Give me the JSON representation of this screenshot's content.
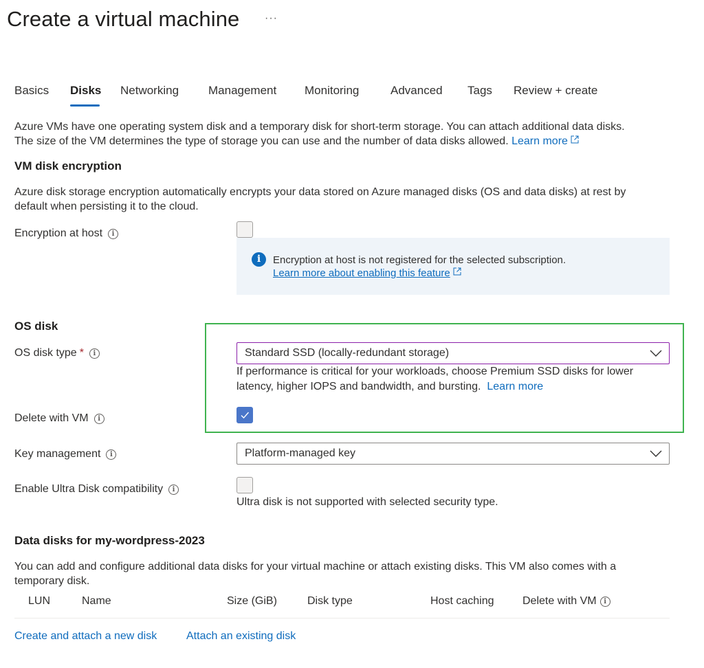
{
  "page": {
    "title": "Create a virtual machine",
    "more": "···"
  },
  "tabs": [
    {
      "label": "Basics",
      "active": false
    },
    {
      "label": "Disks",
      "active": true
    },
    {
      "label": "Networking",
      "active": false
    },
    {
      "label": "Management",
      "active": false
    },
    {
      "label": "Monitoring",
      "active": false
    },
    {
      "label": "Advanced",
      "active": false
    },
    {
      "label": "Tags",
      "active": false
    },
    {
      "label": "Review + create",
      "active": false
    }
  ],
  "intro": {
    "line1": "Azure VMs have one operating system disk and a temporary disk for short-term storage. You can attach additional data disks.",
    "line2": "The size of the VM determines the type of storage you can use and the number of data disks allowed.",
    "learn_more": "Learn more"
  },
  "encryption": {
    "heading": "VM disk encryption",
    "desc_line1": "Azure disk storage encryption automatically encrypts your data stored on Azure managed disks (OS and data disks) at rest by",
    "desc_line2": "default when persisting it to the cloud.",
    "host_label": "Encryption at host",
    "host_checked": false,
    "notice": "Encryption at host is not registered for the selected subscription.",
    "notice_link": "Learn more about enabling this feature"
  },
  "os_disk": {
    "heading": "OS disk",
    "type_label": "OS disk type",
    "type_required": "*",
    "type_value": "Standard SSD (locally-redundant storage)",
    "hint_line1": "If performance is critical for your workloads, choose Premium SSD disks for lower",
    "hint_line2": "latency, higher IOPS and bandwidth, and bursting.",
    "hint_link": "Learn more",
    "delete_label": "Delete with VM",
    "delete_checked": true,
    "key_label": "Key management",
    "key_value": "Platform-managed key",
    "ultra_label": "Enable Ultra Disk compatibility",
    "ultra_checked": false,
    "ultra_note": "Ultra disk is not supported with selected security type."
  },
  "data_disks": {
    "heading": "Data disks for my-wordpress-2023",
    "desc_line1": "You can add and configure additional data disks for your virtual machine or attach existing disks. This VM also comes with a",
    "desc_line2": "temporary disk.",
    "columns": [
      "LUN",
      "Name",
      "Size (GiB)",
      "Disk type",
      "Host caching",
      "Delete with VM"
    ],
    "create_link": "Create and attach a new disk",
    "attach_link": "Attach an existing disk"
  },
  "colors": {
    "accent": "#0f6cbd",
    "checked": "#4a76c9",
    "highlight": "#3fb34f",
    "focus_border": "#8b1fa9",
    "info_bg": "#eff4f9"
  }
}
